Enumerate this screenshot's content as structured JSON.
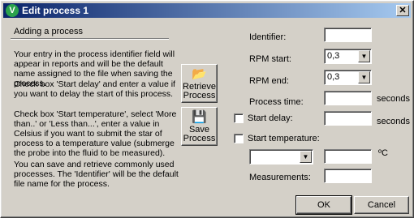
{
  "window": {
    "title": "Edit process 1",
    "close_glyph": "✕"
  },
  "left": {
    "section_title": "Adding a process",
    "para1": "Your entry in the process identifier field will appear in reports and will be the default name assigned to the file when saving the process.",
    "para2": "Check box 'Start delay' and enter a value if you want to delay the start of this process.",
    "para3": "Check box 'Start temperature', select 'More than..' or 'Less than...', enter a value in Celsius if you want to submit the star of process to a temperature value (submerge the probe into the fluid to be measured).",
    "para4": "You can save and retrieve commonly used processes. The 'Identifier' will be the default file name for the process."
  },
  "buttons": {
    "retrieve_line1": "Retrieve",
    "retrieve_line2": "Process",
    "retrieve_icon": "folder-open-icon",
    "save_line1": "Save",
    "save_line2": "Process",
    "save_icon": "floppy-disk-icon",
    "ok": "OK",
    "cancel": "Cancel"
  },
  "form": {
    "identifier_label": "Identifier:",
    "identifier_value": "",
    "rpm_start_label": "RPM start:",
    "rpm_start_value": "0,3",
    "rpm_end_label": "RPM end:",
    "rpm_end_value": "0,3",
    "process_time_label": "Process time:",
    "process_time_value": "",
    "process_time_unit": "seconds",
    "start_delay_label": "Start delay:",
    "start_delay_checked": false,
    "start_delay_value": "",
    "start_delay_unit": "seconds",
    "start_temp_label": "Start temperature:",
    "start_temp_checked": false,
    "temp_compare_value": "",
    "temp_value": "",
    "temp_unit": "ºC",
    "measurements_label": "Measurements:",
    "measurements_value": ""
  },
  "glyphs": {
    "dropdown_arrow": "▼"
  }
}
